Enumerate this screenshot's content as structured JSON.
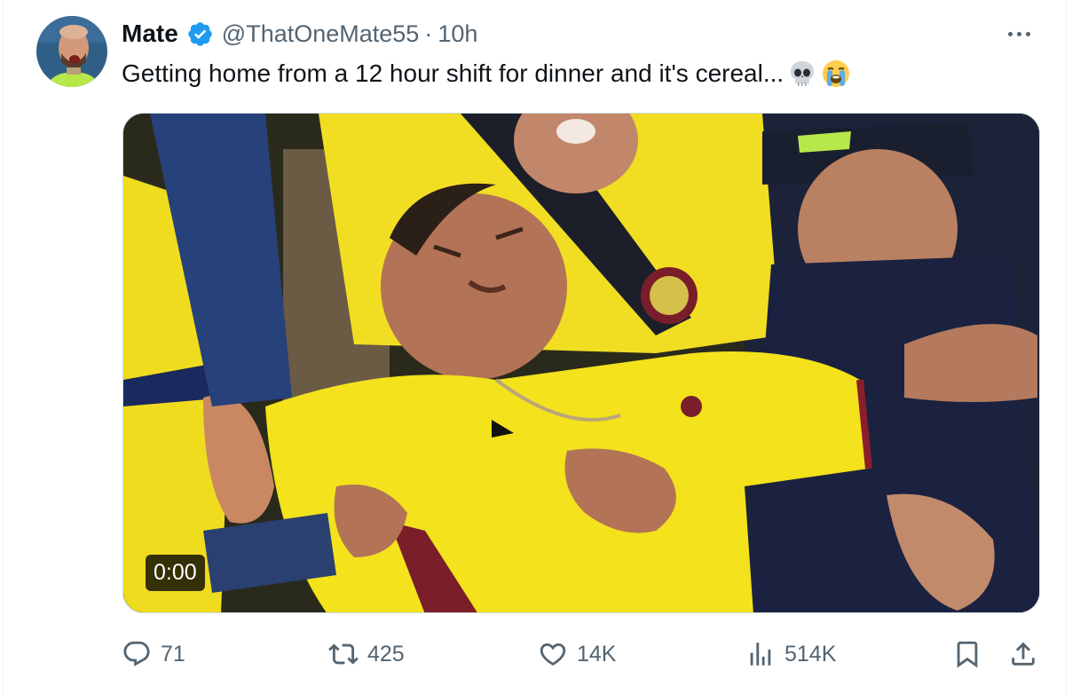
{
  "author": {
    "name": "Mate",
    "handle": "@ThatOneMate55",
    "time": "10h",
    "separator": "·"
  },
  "tweet": {
    "text": "Getting home from a 12 hour shift for dinner and it's cereal..."
  },
  "media": {
    "video_timestamp": "0:00"
  },
  "actions": {
    "replies": "71",
    "retweets": "425",
    "likes": "14K",
    "views": "514K"
  },
  "icons": {
    "verified": "verified-badge-icon",
    "more": "more-icon",
    "emoji1": "skull-emoji",
    "emoji2": "loudly-crying-emoji",
    "reply": "reply-icon",
    "retweet": "retweet-icon",
    "like": "heart-icon",
    "views": "views-icon",
    "bookmark": "bookmark-icon",
    "share": "share-icon"
  },
  "colors": {
    "verified": "#1d9bf0",
    "text": "#0f1419",
    "secondary": "#536471",
    "jersey_yellow": "#f2e21c"
  }
}
